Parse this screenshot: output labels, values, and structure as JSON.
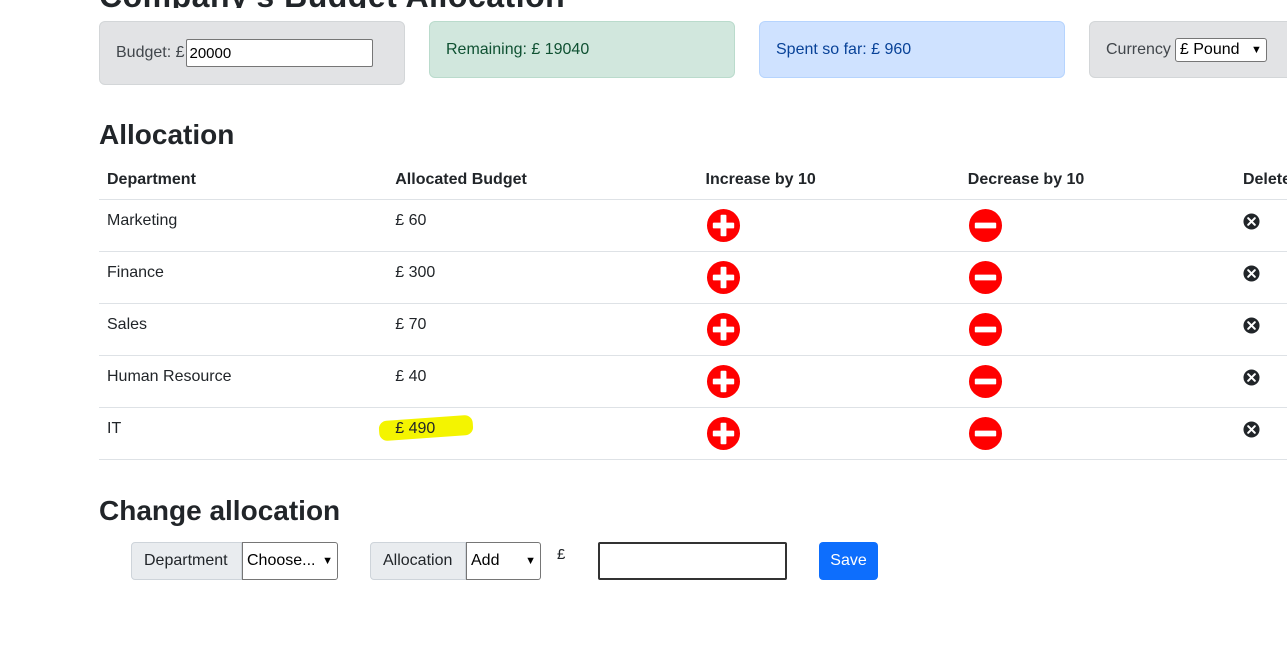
{
  "header": {
    "title": "Company's Budget Allocation"
  },
  "budget": {
    "label": "Budget: £",
    "value": "20000"
  },
  "remaining": {
    "text": "Remaining: £ 19040"
  },
  "spent": {
    "text": "Spent so far: £ 960"
  },
  "currency": {
    "label": "Currency",
    "selected": "£ Pound"
  },
  "allocation": {
    "heading": "Allocation",
    "columns": [
      "Department",
      "Allocated Budget",
      "Increase by 10",
      "Decrease by 10",
      "Delete"
    ],
    "rows": [
      {
        "department": "Marketing",
        "budget": "£ 60"
      },
      {
        "department": "Finance",
        "budget": "£ 300"
      },
      {
        "department": "Sales",
        "budget": "£ 70"
      },
      {
        "department": "Human Resource",
        "budget": "£ 40"
      },
      {
        "department": "IT",
        "budget": "£ 490"
      }
    ],
    "highlighted_row": 4
  },
  "change": {
    "heading": "Change allocation",
    "department_label": "Department",
    "department_selected": "Choose...",
    "allocation_label": "Allocation",
    "allocation_selected": "Add",
    "currency_symbol": "£",
    "amount_value": "",
    "save_label": "Save"
  },
  "colors": {
    "increase_icon": "#ff0000",
    "decrease_icon": "#ff0000",
    "delete_icon": "#212529",
    "save_button": "#0d6efd",
    "highlight": "#f4f400"
  },
  "icons": {
    "increase": "plus-circle-icon",
    "decrease": "minus-circle-icon",
    "delete": "x-circle-icon"
  }
}
